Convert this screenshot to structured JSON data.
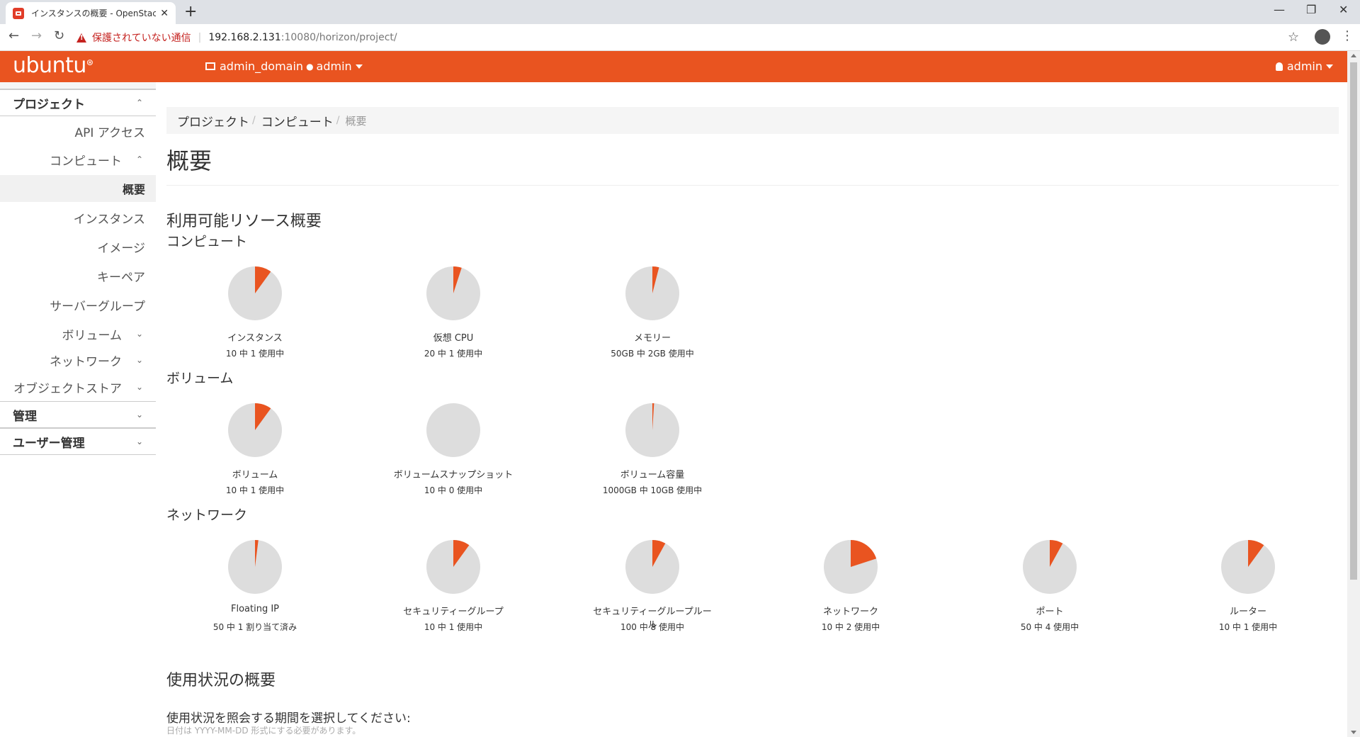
{
  "browser": {
    "tab_title": "インスタンスの概要 - OpenStack Da",
    "tab_close": "✕",
    "new_tab": "+",
    "insecure_label": "保護されていない通信",
    "url_host": "192.168.2.131",
    "url_path": ":10080/horizon/project/",
    "win_minimize": "—",
    "win_restore": "❐",
    "win_close": "✕"
  },
  "header": {
    "brand": "ubuntu",
    "brand_mark": "⊛",
    "domain": "admin_domain",
    "project": "admin",
    "user": "admin"
  },
  "sidebar": {
    "project_section": "プロジェクト",
    "api_access": "API アクセス",
    "compute": "コンピュート",
    "overview": "概要",
    "instances": "インスタンス",
    "images": "イメージ",
    "keypairs": "キーペア",
    "server_groups": "サーバーグループ",
    "volumes": "ボリューム",
    "network": "ネットワーク",
    "object_store": "オブジェクトストア",
    "admin_section": "管理",
    "identity_section": "ユーザー管理",
    "chev_up": "⌃",
    "chev_down": "⌄"
  },
  "main": {
    "breadcrumb": [
      "プロジェクト",
      "コンピュート",
      "概要"
    ],
    "breadcrumb_sep": "/",
    "page_title": "概要",
    "limits_title": "利用可能リソース概要",
    "compute_group": "コンピュート",
    "volume_group": "ボリューム",
    "network_group": "ネットワーク",
    "usage_title": "使用状況の概要",
    "period_label": "使用状況を照会する期間を選択してください:",
    "date_help": "日付は YYYY-MM-DD 形式にする必要があります。"
  },
  "pies": {
    "instances": {
      "label": "インスタンス",
      "usage": "10 中 1 使用中",
      "fraction": 0.1
    },
    "vcpus": {
      "label": "仮想 CPU",
      "usage": "20 中 1 使用中",
      "fraction": 0.05
    },
    "ram": {
      "label": "メモリー",
      "usage": "50GB 中 2GB 使用中",
      "fraction": 0.04
    },
    "volumes": {
      "label": "ボリューム",
      "usage": "10 中 1 使用中",
      "fraction": 0.1
    },
    "snapshots": {
      "label": "ボリュームスナップショット",
      "usage": "10 中 0 使用中",
      "fraction": 0
    },
    "volume_storage": {
      "label": "ボリューム容量",
      "usage": "1000GB 中 10GB 使用中",
      "fraction": 0.01
    },
    "floating_ips": {
      "label": "Floating IP",
      "usage": "50 中 1 割り当て済み",
      "fraction": 0.02
    },
    "security_groups": {
      "label": "セキュリティーグループ",
      "usage": "10 中 1 使用中",
      "fraction": 0.1
    },
    "security_group_rules": {
      "label": "セキュリティーグループルール",
      "usage": "100 中 8 使用中",
      "fraction": 0.08
    },
    "networks": {
      "label": "ネットワーク",
      "usage": "10 中 2 使用中",
      "fraction": 0.2
    },
    "ports": {
      "label": "ポート",
      "usage": "50 中 4 使用中",
      "fraction": 0.08
    },
    "routers": {
      "label": "ルーター",
      "usage": "10 中 1 使用中",
      "fraction": 0.1
    }
  },
  "colors": {
    "accent": "#e95420",
    "pie_background": "#dddddd"
  }
}
